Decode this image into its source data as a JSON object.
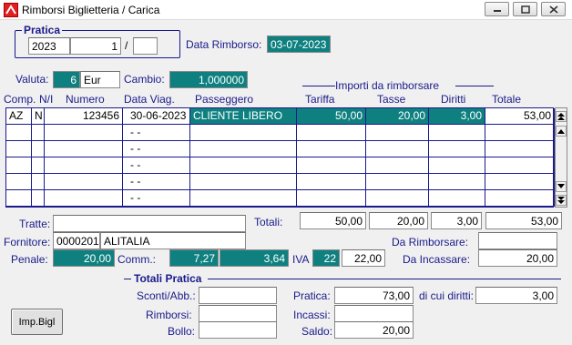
{
  "window": {
    "title": "Rimborsi Biglietteria / Carica"
  },
  "pratica": {
    "legend": "Pratica",
    "anno": "2023",
    "numero": "1",
    "sep": "/",
    "suffisso": ""
  },
  "data_rimborso": {
    "label": "Data Rimborso:",
    "value": "03-07-2023"
  },
  "valuta": {
    "label": "Valuta:",
    "code": "6",
    "name": "Eur"
  },
  "cambio": {
    "label": "Cambio:",
    "value": "1,000000"
  },
  "importi_header": "Importi da rimborsare",
  "columns": {
    "comp": "Comp.",
    "ni": "N/I",
    "numero": "Numero",
    "data_viag": "Data Viag.",
    "passeggero": "Passeggero",
    "tariffa": "Tariffa",
    "tasse": "Tasse",
    "diritti": "Diritti",
    "totale": "Totale"
  },
  "rows": [
    {
      "comp": "AZ",
      "ni": "N",
      "numero": "123456",
      "data": "30-06-2023",
      "passeggero": "CLIENTE LIBERO",
      "tariffa": "50,00",
      "tasse": "20,00",
      "diritti": "3,00",
      "totale": "53,00"
    },
    {
      "comp": "",
      "ni": "",
      "numero": "",
      "data": "- -",
      "passeggero": "",
      "tariffa": "",
      "tasse": "",
      "diritti": "",
      "totale": ""
    },
    {
      "comp": "",
      "ni": "",
      "numero": "",
      "data": "- -",
      "passeggero": "",
      "tariffa": "",
      "tasse": "",
      "diritti": "",
      "totale": ""
    },
    {
      "comp": "",
      "ni": "",
      "numero": "",
      "data": "- -",
      "passeggero": "",
      "tariffa": "",
      "tasse": "",
      "diritti": "",
      "totale": ""
    },
    {
      "comp": "",
      "ni": "",
      "numero": "",
      "data": "- -",
      "passeggero": "",
      "tariffa": "",
      "tasse": "",
      "diritti": "",
      "totale": ""
    },
    {
      "comp": "",
      "ni": "",
      "numero": "",
      "data": "- -",
      "passeggero": "",
      "tariffa": "",
      "tasse": "",
      "diritti": "",
      "totale": ""
    }
  ],
  "tratte": {
    "label": "Tratte:",
    "value": ""
  },
  "totali": {
    "label": "Totali:",
    "tariffa": "50,00",
    "tasse": "20,00",
    "diritti": "3,00",
    "totale": "53,00"
  },
  "fornitore": {
    "label": "Fornitore:",
    "code": "0000201",
    "name": "ALITALIA"
  },
  "da_rimborsare": {
    "label": "Da Rimborsare:",
    "value": ""
  },
  "penale": {
    "label": "Penale:",
    "value": "20,00"
  },
  "comm": {
    "label": "Comm.:",
    "perc": "7,27",
    "value": "3,64"
  },
  "iva": {
    "label": "IVA",
    "aliquota": "22",
    "value": "22,00"
  },
  "da_incassare": {
    "label": "Da Incassare:",
    "value": "20,00"
  },
  "totali_pratica": {
    "legend": "Totali Pratica",
    "sconti_label": "Sconti/Abb.:",
    "sconti": "",
    "rimborsi_label": "Rimborsi:",
    "rimborsi": "",
    "bollo_label": "Bollo:",
    "bollo": "",
    "pratica_label": "Pratica:",
    "pratica": "73,00",
    "diritti_label": "di cui diritti:",
    "diritti": "3,00",
    "incassi_label": "Incassi:",
    "incassi": "",
    "saldo_label": "Saldo:",
    "saldo": "20,00"
  },
  "imp_bigl_button": "Imp.Bigl",
  "colors": {
    "accent": "#0f8080",
    "label_blue": "#1a1a8c"
  }
}
